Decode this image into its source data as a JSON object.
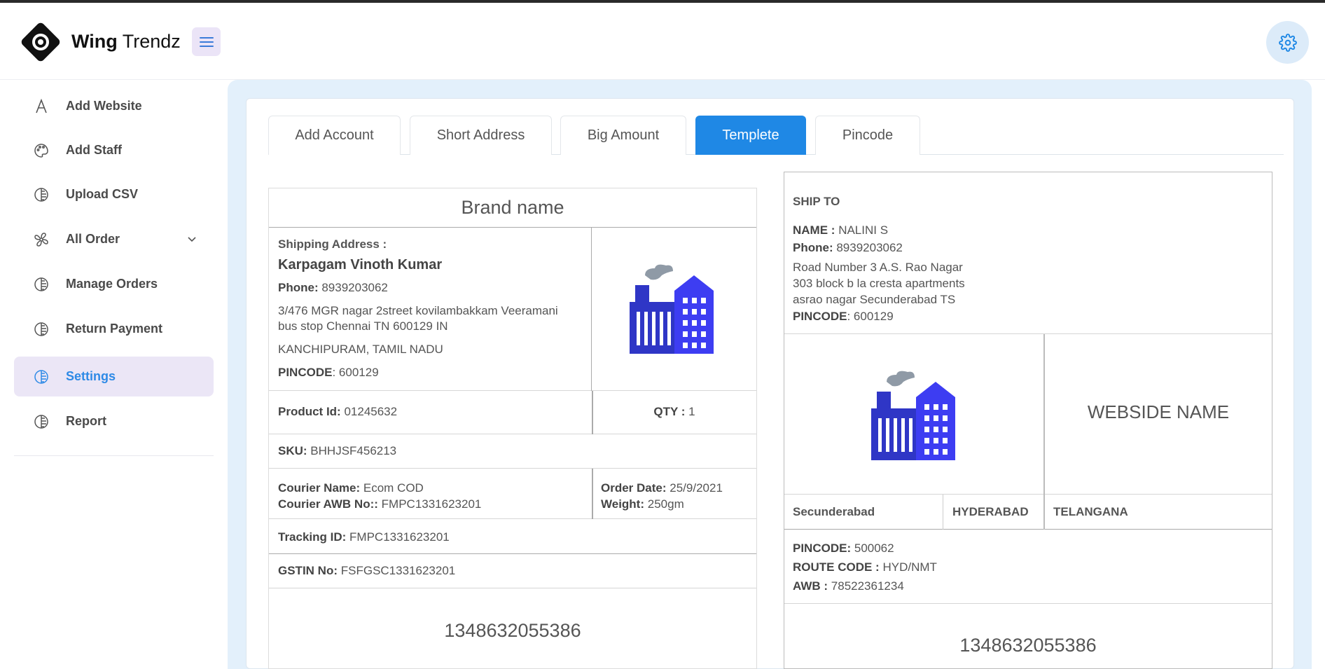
{
  "header": {
    "brand_bold": "Wing",
    "brand_light": "Trendz",
    "menu_icon": "hamburger-icon",
    "settings_icon": "gear-icon"
  },
  "sidebar": {
    "items": [
      {
        "label": "Add Website",
        "icon": "font-icon"
      },
      {
        "label": "Add Staff",
        "icon": "palette-icon"
      },
      {
        "label": "Upload CSV",
        "icon": "circle-icon"
      },
      {
        "label": "All Order",
        "icon": "fan-icon"
      },
      {
        "label": "Manage Orders",
        "icon": "circle-icon"
      },
      {
        "label": "Return Payment",
        "icon": "circle-icon"
      },
      {
        "label": "Settings",
        "icon": "circle-icon"
      },
      {
        "label": "Report",
        "icon": "circle-icon"
      }
    ],
    "active": "Settings"
  },
  "tabs": [
    "Add Account",
    "Short Address",
    "Big Amount",
    "Templete",
    "Pincode"
  ],
  "active_tab": "Templete",
  "colors": {
    "accent": "#1f88e5",
    "active_bg": "#ebe6f6",
    "page_bg": "#e3f0fb",
    "factory_blue": "#3d3df2"
  },
  "label1": {
    "brand_name": "Brand name",
    "shipping_address_label": "Shipping Address :",
    "customer_name": "Karpagam Vinoth Kumar",
    "phone_label": "Phone:",
    "phone": "8939203062",
    "address": "3/476 MGR nagar 2street kovilambakkam Veeramani bus stop Chennai TN 600129 IN",
    "district_state": "KANCHIPURAM, TAMIL NADU",
    "pincode_label": "PINCODE",
    "pincode": ": 600129",
    "product_id_label": "Product Id:",
    "product_id": "01245632",
    "qty_label": "QTY :",
    "qty": "1",
    "sku_label": "SKU:",
    "sku": "BHHJSF456213",
    "courier_name_label": "Courier Name:",
    "courier_name": "Ecom COD",
    "courier_awb_label": "Courier AWB No::",
    "courier_awb": "FMPC1331623201",
    "order_date_label": "Order Date:",
    "order_date": "25/9/2021",
    "weight_label": "Weight:",
    "weight": "250gm",
    "tracking_label": "Tracking ID:",
    "tracking": "FMPC1331623201",
    "gstin_label": "GSTIN No:",
    "gstin": "FSFGSC1331623201",
    "barcode_number": "1348632055386"
  },
  "label2": {
    "ship_to": "SHIP TO",
    "name_label": "NAME :",
    "name": "NALINI S",
    "phone_label": "Phone:",
    "phone": "8939203062",
    "address_line1": "Road Number 3 A.S. Rao Nagar",
    "address_line2": "303 block b la cresta apartments",
    "address_line3": "asrao nagar Secunderabad TS",
    "pincode_label": "PINCODE",
    "pincode": ": 600129",
    "website_name": "WEBSIDE NAME",
    "city": "Secunderabad",
    "district": "HYDERABAD",
    "state": "TELANGANA",
    "pincode2_label": "PINCODE:",
    "pincode2": "500062",
    "route_label": "ROUTE CODE :",
    "route": "HYD/NMT",
    "awb_label": "AWB :",
    "awb": "78522361234",
    "barcode_number": "1348632055386"
  }
}
